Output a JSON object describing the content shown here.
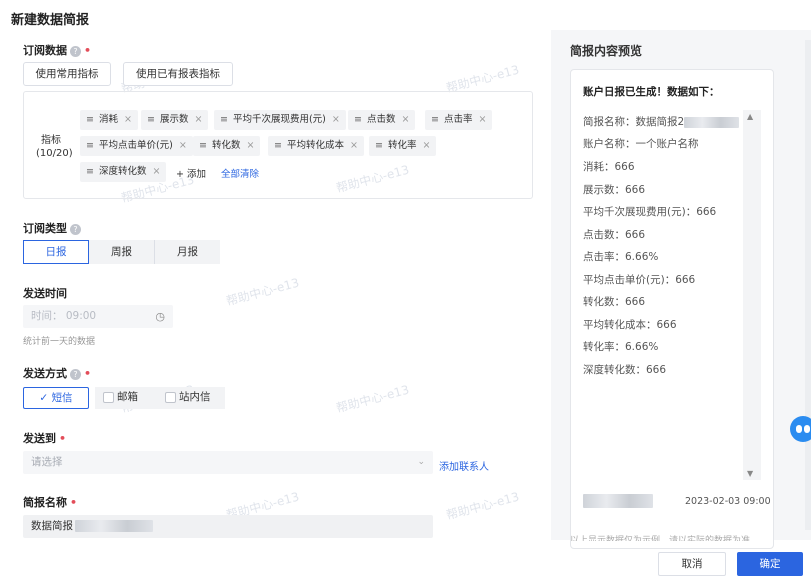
{
  "page": {
    "title": "新建数据简报"
  },
  "watermark": "帮助中心-e13",
  "subscribe_data": {
    "label": "订阅数据",
    "btn_common": "使用常用指标",
    "btn_existing": "使用已有报表指标",
    "metric_label": "指标",
    "metric_count": "(10/20)",
    "tags": [
      "消耗",
      "展示数",
      "平均千次展现费用(元)",
      "点击数",
      "点击率",
      "平均点击单价(元)",
      "转化数",
      "平均转化成本",
      "转化率",
      "深度转化数"
    ],
    "add_label": "添加",
    "clear_label": "全部清除"
  },
  "subscribe_type": {
    "label": "订阅类型",
    "options": [
      "日报",
      "周报",
      "月报"
    ],
    "selected": "日报"
  },
  "send_time": {
    "label": "发送时间",
    "placeholder": "时间： 09:00",
    "hint": "统计前一天的数据"
  },
  "send_method": {
    "label": "发送方式",
    "options": [
      {
        "label": "短信",
        "checked": true
      },
      {
        "label": "邮箱",
        "checked": false
      },
      {
        "label": "站内信",
        "checked": false
      }
    ]
  },
  "send_to": {
    "label": "发送到",
    "placeholder": "请选择",
    "add_contact": "添加联系人"
  },
  "report_name": {
    "label": "简报名称",
    "value": "数据简报"
  },
  "preview": {
    "title": "简报内容预览",
    "heading": "账户日报已生成！数据如下：",
    "lines": [
      "简报名称：数据简报2",
      "账户名称：一个账户名称",
      "消耗：666",
      "展示数：666",
      "平均千次展现费用(元)：666",
      "点击数：666",
      "点击率：6.66%",
      "平均点击单价(元)：666",
      "转化数：666",
      "平均转化成本：666",
      "转化率：6.66%",
      "深度转化数：666"
    ],
    "date": "2023-02-03 09:00",
    "footnote": "以上显示数据仅为示例，请以实际的数据为准"
  },
  "footer": {
    "cancel": "取消",
    "confirm": "确定"
  },
  "colors": {
    "accent": "#2b65e0",
    "required": "#e34d59"
  }
}
